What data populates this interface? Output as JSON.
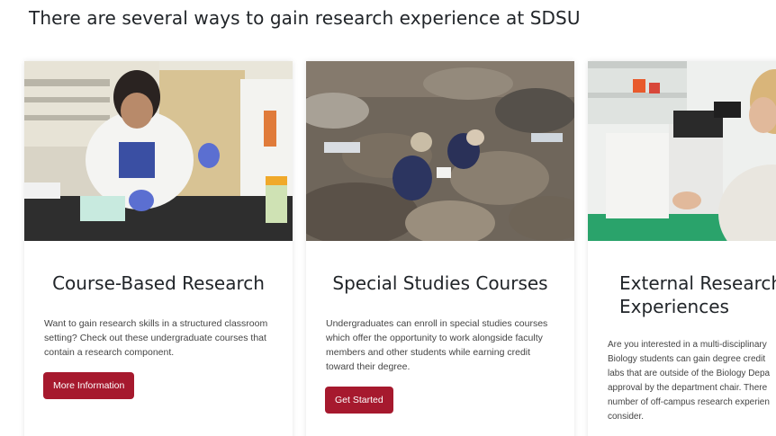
{
  "page": {
    "heading": "There are several ways to gain research experience at SDSU"
  },
  "cards": [
    {
      "title": "Course-Based Research",
      "text": "Want to gain research skills in a structured classroom setting? Check out these undergraduate courses that contain a research component.",
      "button": "More Information",
      "image": "student-in-lab-photo"
    },
    {
      "title": "Special Studies Courses",
      "text": "Undergraduates can enroll in special studies courses which offer the opportunity to work alongside faculty members and other students while earning credit toward their degree.",
      "button": "Get Started",
      "image": "tidepool-fieldwork-photo"
    },
    {
      "title_lines": [
        "External Research",
        "Experiences"
      ],
      "text_lines": [
        "Are you interested in a multi-disciplinary",
        "Biology students can gain degree credit",
        "labs that are outside of the Biology Depa",
        "approval by the department chair. There",
        "number of off-campus research experien",
        "consider."
      ],
      "image": "microscope-researcher-photo"
    }
  ],
  "colors": {
    "button_bg": "#a6192e",
    "button_text": "#ffffff",
    "heading": "#212529"
  }
}
